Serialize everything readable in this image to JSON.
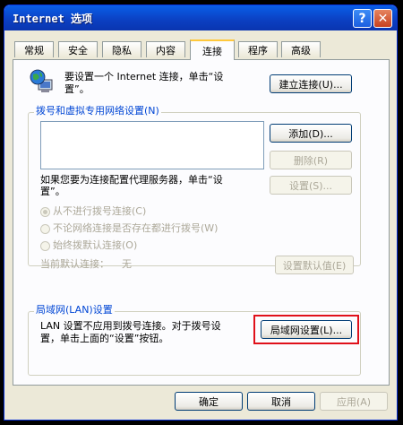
{
  "window": {
    "title": "Internet 选项",
    "help_glyph": "?",
    "close_glyph": "✕"
  },
  "tabs": [
    {
      "label": "常规"
    },
    {
      "label": "安全"
    },
    {
      "label": "隐私"
    },
    {
      "label": "内容"
    },
    {
      "label": "连接",
      "active": true
    },
    {
      "label": "程序"
    },
    {
      "label": "高级"
    }
  ],
  "connection": {
    "setup_text_line1": "要设置一个 Internet 连接，单击“设",
    "setup_text_line2": "置”。",
    "setup_button": "建立连接(U)..."
  },
  "dialup": {
    "group_label": "拨号和虚拟专用网络设置(N)",
    "add_button": "添加(D)...",
    "remove_button": "删除(R)",
    "settings_button": "设置(S)...",
    "proxy_text_line1": "如果您要为连接配置代理服务器，单击“设",
    "proxy_text_line2": "置”。",
    "radio_never": "从不进行拨号连接(C)",
    "radio_when_no_network": "不论网络连接是否存在都进行拨号(W)",
    "radio_always": "始终拨默认连接(O)",
    "current_default_label": "当前默认连接：",
    "current_default_value": "无",
    "set_default_button": "设置默认值(E)"
  },
  "lan": {
    "group_label": "局域网(LAN)设置",
    "text_line1": "LAN 设置不应用到拨号连接。对于拨号设",
    "text_line2": "置，单击上面的“设置”按钮。",
    "lan_settings_button": "局域网设置(L)..."
  },
  "footer": {
    "ok_button": "确定",
    "cancel_button": "取消",
    "apply_button": "应用(A)"
  },
  "colors": {
    "highlight": "#e0101a",
    "titlebar": "#0a4fd8",
    "group_label": "#0046d5"
  }
}
